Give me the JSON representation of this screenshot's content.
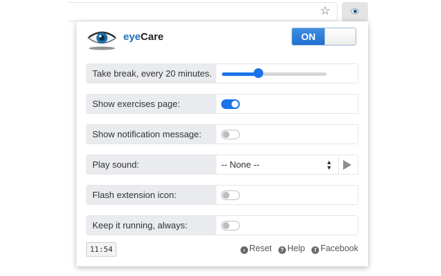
{
  "browser": {
    "star_icon": "☆",
    "extension_icon": "eye-icon"
  },
  "header": {
    "app_name_prefix": "eye",
    "app_name_suffix": "Care",
    "power_label": "ON"
  },
  "settings": {
    "break_label": "Take break, every 20 minutes.",
    "break_slider_value": 0.35,
    "exercises_label": "Show exercises page:",
    "exercises_enabled": true,
    "notification_label": "Show notification message:",
    "notification_enabled": false,
    "sound_label": "Play sound:",
    "sound_selected": "-- None --",
    "flash_label": "Flash extension icon:",
    "flash_enabled": false,
    "running_label": "Keep it running, always:",
    "running_enabled": false
  },
  "footer": {
    "timer": "11:54",
    "reset_label": "Reset",
    "help_label": "Help",
    "facebook_label": "Facebook"
  },
  "colors": {
    "accent": "#1a73e8",
    "label_bg": "#e9ebee"
  }
}
